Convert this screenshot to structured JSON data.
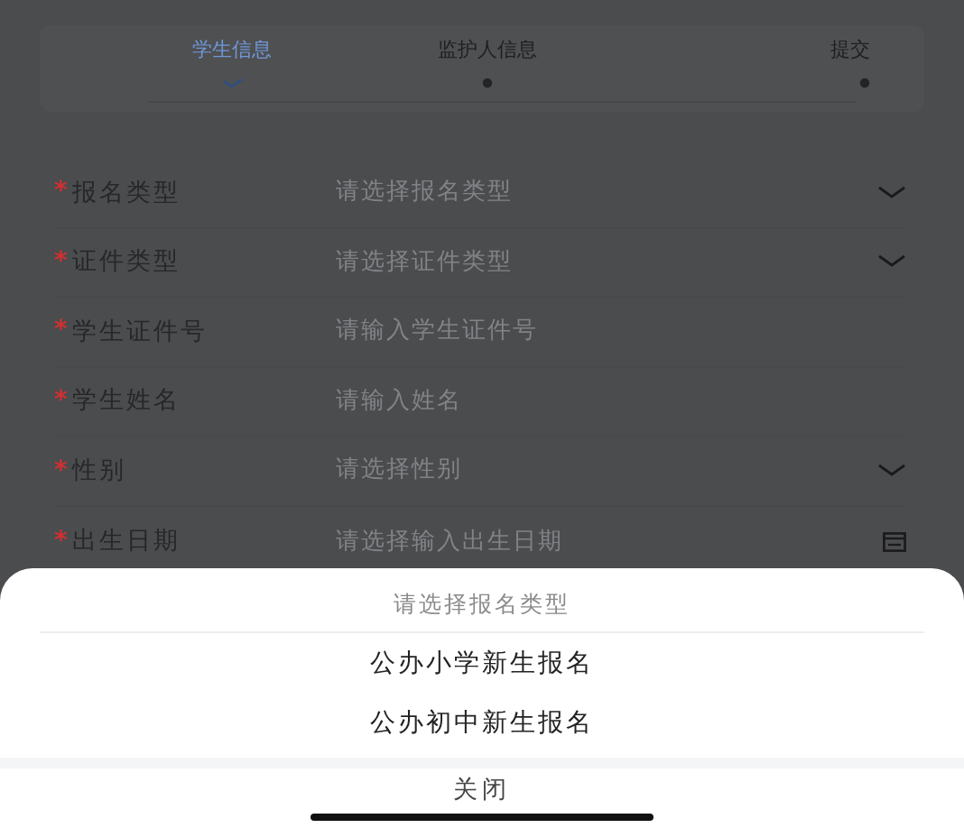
{
  "steps": [
    {
      "label": "学生信息",
      "selected": true,
      "kind": "done"
    },
    {
      "label": "监护人信息",
      "selected": false,
      "kind": "pending"
    },
    {
      "label": "提交",
      "selected": false,
      "kind": "pending"
    }
  ],
  "fields": [
    {
      "required_mark": "*",
      "label": "报名类型",
      "placeholder": "请选择报名类型",
      "kind": "select"
    },
    {
      "required_mark": "*",
      "label": "证件类型",
      "placeholder": "请选择证件类型",
      "kind": "select"
    },
    {
      "required_mark": "*",
      "label": "学生证件号",
      "placeholder": "请输入学生证件号",
      "kind": "text"
    },
    {
      "required_mark": "*",
      "label": "学生姓名",
      "placeholder": "请输入姓名",
      "kind": "text"
    },
    {
      "required_mark": "*",
      "label": "性别",
      "placeholder": "请选择性别",
      "kind": "select"
    },
    {
      "required_mark": "*",
      "label": "出生日期",
      "placeholder": "请选择输入出生日期",
      "kind": "date"
    }
  ],
  "sheet": {
    "title": "请选择报名类型",
    "options": [
      "公办小学新生报名",
      "公办初中新生报名"
    ],
    "close": "关闭"
  }
}
